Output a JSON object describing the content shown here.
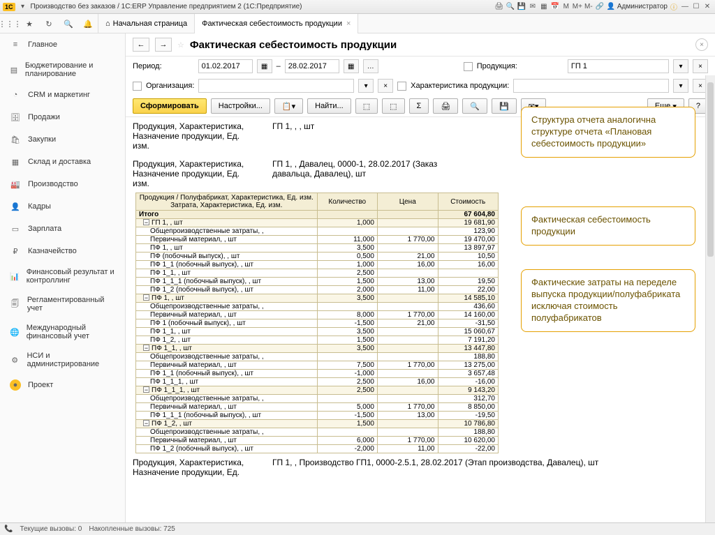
{
  "titlebar": {
    "app_title": "Производство без заказов / 1С:ERP Управление предприятием 2 (1С:Предприятие)",
    "user": "Администратор",
    "m_buttons": [
      "M",
      "M+",
      "M-"
    ]
  },
  "home_tab": "Начальная страница",
  "tab_label": "Фактическая себестоимость продукции",
  "sidebar": {
    "items": [
      {
        "icon": "≡",
        "label": "Главное"
      },
      {
        "icon": "▤",
        "label": "Бюджетирование и планирование"
      },
      {
        "icon": "◔",
        "label": "CRM и маркетинг"
      },
      {
        "icon": "🗄",
        "label": "Продажи"
      },
      {
        "icon": "🛍",
        "label": "Закупки"
      },
      {
        "icon": "▦",
        "label": "Склад и доставка"
      },
      {
        "icon": "🏭",
        "label": "Производство"
      },
      {
        "icon": "👤",
        "label": "Кадры"
      },
      {
        "icon": "▭",
        "label": "Зарплата"
      },
      {
        "icon": "₽",
        "label": "Казначейство"
      },
      {
        "icon": "📊",
        "label": "Финансовый результат и контроллинг"
      },
      {
        "icon": "🗐",
        "label": "Регламентированный учет"
      },
      {
        "icon": "🌐",
        "label": "Международный финансовый учет"
      },
      {
        "icon": "⚙",
        "label": "НСИ и администрирование"
      },
      {
        "icon": "●",
        "label": "Проект"
      }
    ]
  },
  "page": {
    "title": "Фактическая себестоимость продукции",
    "period_label": "Период:",
    "date_from": "01.02.2017",
    "date_to": "28.02.2017",
    "sep": "–",
    "org_label": "Организация:",
    "prod_label": "Продукция:",
    "prod_value": "ГП 1",
    "char_label": "Характеристика продукции:",
    "btn_form": "Сформировать",
    "btn_settings": "Настройки...",
    "btn_find": "Найти...",
    "btn_more": "Еще",
    "btn_help": "?"
  },
  "groups": [
    {
      "left": "Продукция, Характеристика,\nНазначение продукции, Ед.\nизм.",
      "right": "ГП 1, , , шт"
    },
    {
      "left": "Продукция, Характеристика,\nНазначение продукции, Ед.\nизм.",
      "right": "ГП 1, , Давалец, 0000-1, 28.02.2017 (Заказ давальца, Давалец), шт"
    }
  ],
  "headers": [
    "Продукция / Полуфабрикат, Характеристика, Ед. изм.\nЗатрата, Характеристика, Ед. изм.",
    "Количество",
    "Цена",
    "Стоимость"
  ],
  "rows": [
    {
      "l": 0,
      "n": "Итого",
      "q": "",
      "p": "",
      "s": "67 604,80"
    },
    {
      "l": 1,
      "n": "ГП 1, , шт",
      "q": "1,000",
      "p": "",
      "s": "19 681,90",
      "exp": true
    },
    {
      "l": 2,
      "n": "Общепроизводственные затраты, ,",
      "q": "",
      "p": "",
      "s": "123,90"
    },
    {
      "l": 2,
      "n": "Первичный материал, , шт",
      "q": "11,000",
      "p": "1 770,00",
      "s": "19 470,00"
    },
    {
      "l": 2,
      "n": "ПФ 1, , шт",
      "q": "3,500",
      "p": "",
      "s": "13 897,97"
    },
    {
      "l": 2,
      "n": "ПФ (побочный выпуск), , шт",
      "q": "0,500",
      "p": "21,00",
      "s": "10,50"
    },
    {
      "l": 2,
      "n": "ПФ 1_1 (побочный выпуск), , шт",
      "q": "1,000",
      "p": "16,00",
      "s": "16,00"
    },
    {
      "l": 2,
      "n": "ПФ 1_1, , шт",
      "q": "2,500",
      "p": "",
      "s": ""
    },
    {
      "l": 2,
      "n": "ПФ 1_1_1 (побочный выпуск), , шт",
      "q": "1,500",
      "p": "13,00",
      "s": "19,50"
    },
    {
      "l": 2,
      "n": "ПФ 1_2 (побочный выпуск), , шт",
      "q": "2,000",
      "p": "11,00",
      "s": "22,00"
    },
    {
      "l": 1,
      "n": "ПФ 1, , шт",
      "q": "3,500",
      "p": "",
      "s": "14 585,10",
      "exp": true
    },
    {
      "l": 2,
      "n": "Общепроизводственные затраты, ,",
      "q": "",
      "p": "",
      "s": "436,60"
    },
    {
      "l": 2,
      "n": "Первичный материал, , шт",
      "q": "8,000",
      "p": "1 770,00",
      "s": "14 160,00"
    },
    {
      "l": 2,
      "n": "ПФ 1 (побочный выпуск), , шт",
      "q": "-1,500",
      "p": "21,00",
      "s": "-31,50"
    },
    {
      "l": 2,
      "n": "ПФ 1_1, , шт",
      "q": "3,500",
      "p": "",
      "s": "15 060,67"
    },
    {
      "l": 2,
      "n": "ПФ 1_2, , шт",
      "q": "1,500",
      "p": "",
      "s": "7 191,20"
    },
    {
      "l": 1,
      "n": "ПФ 1_1, , шт",
      "q": "3,500",
      "p": "",
      "s": "13 447,80",
      "exp": true
    },
    {
      "l": 2,
      "n": "Общепроизводственные затраты, ,",
      "q": "",
      "p": "",
      "s": "188,80"
    },
    {
      "l": 2,
      "n": "Первичный материал, , шт",
      "q": "7,500",
      "p": "1 770,00",
      "s": "13 275,00"
    },
    {
      "l": 2,
      "n": "ПФ 1_1 (побочный выпуск), , шт",
      "q": "-1,000",
      "p": "",
      "s": "3 657,48"
    },
    {
      "l": 2,
      "n": "ПФ 1_1_1, , шт",
      "q": "2,500",
      "p": "16,00",
      "s": "-16,00"
    },
    {
      "l": 1,
      "n": "ПФ 1_1_1, , шт",
      "q": "2,500",
      "p": "",
      "s": "9 143,20",
      "exp": true
    },
    {
      "l": 2,
      "n": "Общепроизводственные затраты, ,",
      "q": "",
      "p": "",
      "s": "312,70"
    },
    {
      "l": 2,
      "n": "Первичный материал, , шт",
      "q": "5,000",
      "p": "1 770,00",
      "s": "8 850,00"
    },
    {
      "l": 2,
      "n": "ПФ 1_1_1 (побочный выпуск), , шт",
      "q": "-1,500",
      "p": "13,00",
      "s": "-19,50"
    },
    {
      "l": 1,
      "n": "ПФ 1_2, , шт",
      "q": "1,500",
      "p": "",
      "s": "10 786,80",
      "exp": true
    },
    {
      "l": 2,
      "n": "Общепроизводственные затраты, ,",
      "q": "",
      "p": "",
      "s": "188,80"
    },
    {
      "l": 2,
      "n": "Первичный материал, , шт",
      "q": "6,000",
      "p": "1 770,00",
      "s": "10 620,00"
    },
    {
      "l": 2,
      "n": "ПФ 1_2 (побочный выпуск), , шт",
      "q": "-2,000",
      "p": "11,00",
      "s": "-22,00"
    }
  ],
  "footer_group": {
    "left": "Продукция, Характеристика,\nНазначение продукции, Ед.",
    "right": "ГП 1, , Производство ГП1, 0000-2.5.1, 28.02.2017 (Этап производства, Давалец), шт"
  },
  "callouts": [
    "Структура отчета аналогична структуре отчета «Плановая себестоимость продукции»",
    "Фактическая себестоимость продукции",
    "Фактические затраты на переделе выпуска продукции/полуфабриката исключая стоимость полуфабрикатов"
  ],
  "statusbar": {
    "a": "Текущие вызовы: 0",
    "b": "Накопленные вызовы: 725"
  }
}
